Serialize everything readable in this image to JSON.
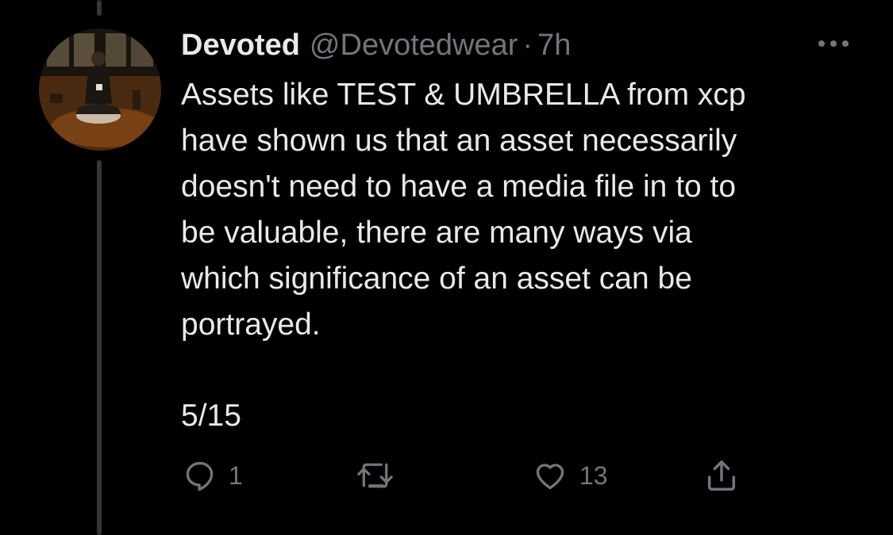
{
  "tweet": {
    "author": {
      "display_name": "Devoted",
      "handle": "@Devotedwear",
      "avatar_icon": "avatar-photo"
    },
    "separator": "·",
    "time": "7h",
    "text": "Assets like TEST & UMBRELLA from xcp\nhave shown us that an asset necessarily\ndoesn't need to have a media file in to to\nbe valuable, there are many ways via\nwhich significance of an asset can be\nportrayed.",
    "thread_count": "5/15",
    "actions": {
      "reply_count": "1",
      "retweet_count": "",
      "like_count": "13"
    }
  },
  "colors": {
    "background": "#000000",
    "text": "#e7e9ea",
    "secondary": "#71767b",
    "thread_line": "#333639"
  },
  "icons": [
    "more-icon",
    "reply-icon",
    "retweet-icon",
    "like-icon",
    "share-icon"
  ]
}
